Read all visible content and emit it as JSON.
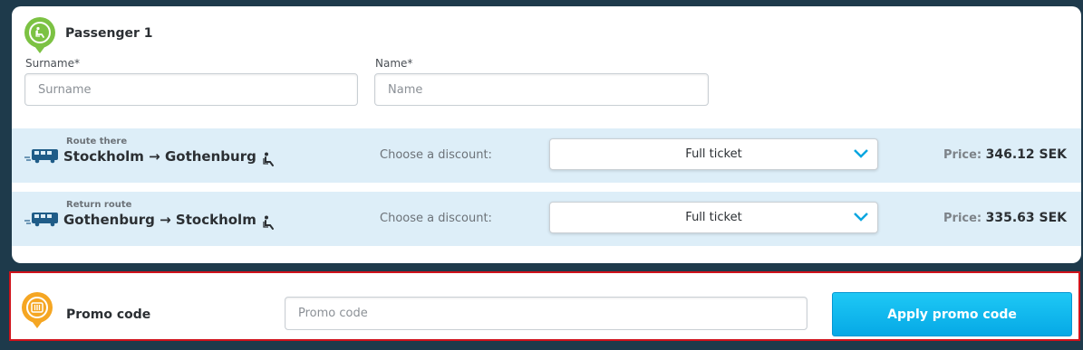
{
  "passenger": {
    "title": "Passenger 1",
    "surname_label": "Surname*",
    "surname_placeholder": "Surname",
    "name_label": "Name*",
    "name_placeholder": "Name"
  },
  "routes": [
    {
      "label": "Route there",
      "from": "Stockholm",
      "arrow": "→",
      "to": "Gothenburg",
      "discount_label": "Choose a discount:",
      "discount_value": "Full ticket",
      "price_label": "Price:",
      "price_value": "346.12 SEK"
    },
    {
      "label": "Return route",
      "from": "Gothenburg",
      "arrow": "→",
      "to": "Stockholm",
      "discount_label": "Choose a discount:",
      "discount_value": "Full ticket",
      "price_label": "Price:",
      "price_value": "335.63 SEK"
    }
  ],
  "promo": {
    "title": "Promo code",
    "placeholder": "Promo code",
    "button_label": "Apply promo code"
  },
  "icons": {
    "passenger": "seat-pin-icon",
    "promo": "ticket-pin-icon",
    "bus": "bus-icon",
    "seat": "seat-icon",
    "chevron": "chevron-down-icon"
  },
  "colors": {
    "background": "#1e3a4b",
    "route_row": "#ddeef8",
    "accent_green": "#7cc243",
    "accent_orange": "#f5a623",
    "button": "#06a9e6",
    "chevron": "#0aa6e0",
    "highlight_border": "#d0121b"
  }
}
